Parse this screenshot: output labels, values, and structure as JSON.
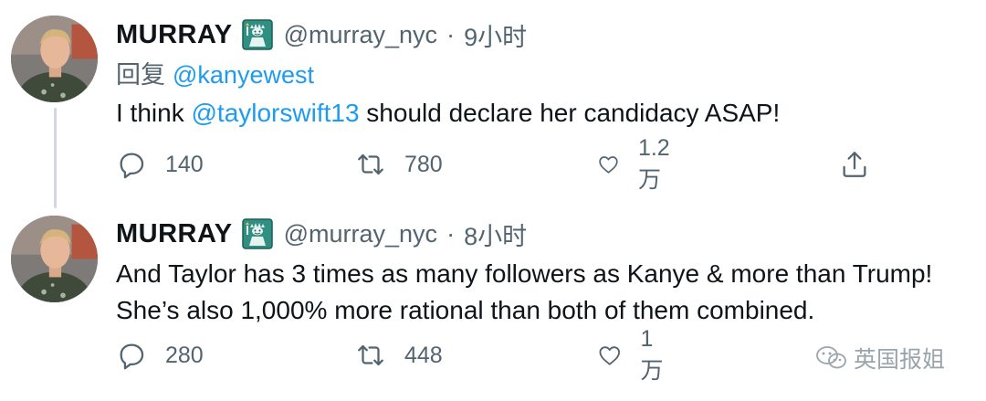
{
  "tweets": [
    {
      "display_name": "MURRAY",
      "badge_icon": "statue-of-liberty-icon",
      "handle": "@murray_nyc",
      "separator": "·",
      "time": "9小时",
      "reply_prefix": "回复",
      "reply_to": "@kanyewest",
      "text_before": "I think ",
      "text_mention": "@taylorswift13",
      "text_after": " should declare her candidacy ASAP!",
      "replies": "140",
      "retweets": "780",
      "likes": "1.2万"
    },
    {
      "display_name": "MURRAY",
      "badge_icon": "statue-of-liberty-icon",
      "handle": "@murray_nyc",
      "separator": "·",
      "time": "8小时",
      "text_line1": "And Taylor has 3 times as many followers as Kanye & more than Trump!",
      "text_line2": "She’s also 1,000% more rational than both of them combined.",
      "replies": "280",
      "retweets": "448",
      "likes": "1万"
    }
  ],
  "watermark": {
    "text": "英国报姐",
    "icon": "wechat-icon"
  },
  "colors": {
    "link": "#1d9bf0",
    "secondary_text": "#536471",
    "primary_text": "#0f1419",
    "thread_line": "#cfd9de"
  }
}
